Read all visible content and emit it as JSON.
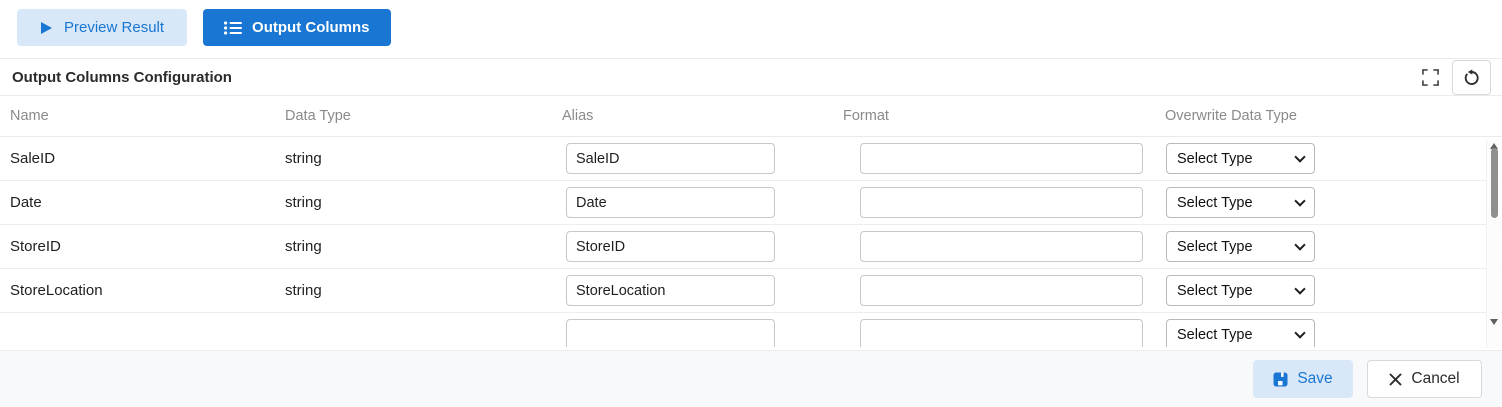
{
  "toolbar": {
    "preview_label": "Preview Result",
    "output_columns_label": "Output Columns"
  },
  "panel": {
    "title": "Output Columns Configuration"
  },
  "table": {
    "headers": [
      "Name",
      "Data Type",
      "Alias",
      "Format",
      "Overwrite Data Type"
    ],
    "rows": [
      {
        "name": "SaleID",
        "data_type": "string",
        "alias": "SaleID",
        "format": "",
        "overwrite": "Select Type"
      },
      {
        "name": "Date",
        "data_type": "string",
        "alias": "Date",
        "format": "",
        "overwrite": "Select Type"
      },
      {
        "name": "StoreID",
        "data_type": "string",
        "alias": "StoreID",
        "format": "",
        "overwrite": "Select Type"
      },
      {
        "name": "StoreLocation",
        "data_type": "string",
        "alias": "StoreLocation",
        "format": "",
        "overwrite": "Select Type"
      },
      {
        "name": "",
        "data_type": "",
        "alias": "",
        "format": "",
        "overwrite": "Select Type"
      }
    ]
  },
  "footer": {
    "save_label": "Save",
    "cancel_label": "Cancel"
  },
  "colors": {
    "accent": "#1976d2",
    "accent_light": "#d9e8f9"
  }
}
